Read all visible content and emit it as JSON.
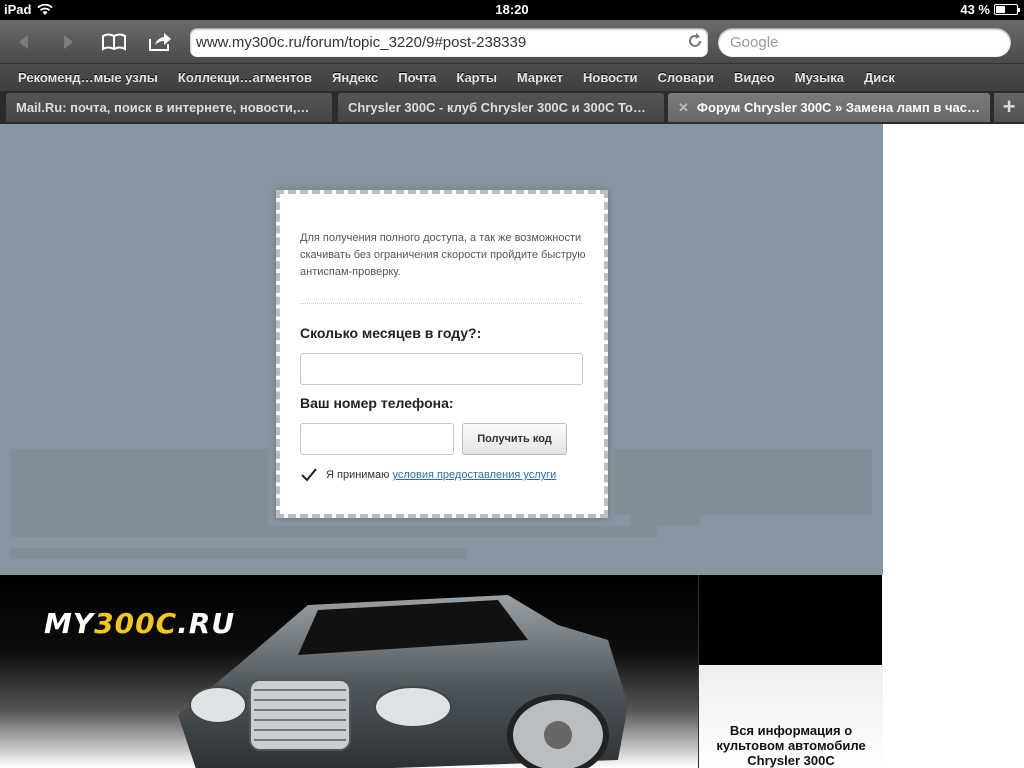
{
  "status_bar": {
    "device": "iPad",
    "time": "18:20",
    "battery": "43 %",
    "battery_level": 0.43
  },
  "toolbar": {
    "url": "www.my300c.ru/forum/topic_3220/9#post-238339",
    "search_placeholder": "Google",
    "icons": [
      "back-icon",
      "forward-icon",
      "bookmarks-icon",
      "share-icon",
      "reload-icon"
    ]
  },
  "bookmarks": [
    "Рекоменд…мые узлы",
    "Коллекци…агментов",
    "Яндекс",
    "Почта",
    "Карты",
    "Маркет",
    "Новости",
    "Словари",
    "Видео",
    "Музыка",
    "Диск"
  ],
  "tabs": [
    {
      "label": "Mail.Ru: почта, поиск в интернете, новости,…",
      "active": false
    },
    {
      "label": "Chrysler 300C - клуб Chrysler 300C и 300C To…",
      "active": false
    },
    {
      "label": "Форум Chrysler 300C » Замена ламп в час…",
      "active": true
    }
  ],
  "modal": {
    "intro": "Для получения полного доступа, а так же возможности скачивать без ограничения скорости пройдите быструю антиспам-проверку.",
    "question_label": "Сколько месяцев в году?:",
    "question_value": "",
    "phone_label": "Ваш номер телефона:",
    "phone_value": "",
    "get_code_button": "Получить код",
    "terms_prefix": "Я принимаю",
    "terms_link": "условия предоставления услуги"
  },
  "banner": {
    "logo_prefix": "MY",
    "logo_accent": "300C",
    "logo_suffix": ".RU",
    "side_text": "Вся информация о культовом автомобиле Chrysler 300C"
  },
  "colors": {
    "overlay": "#8796a0",
    "link": "#2a6db0",
    "logo_accent": "#f5c718"
  }
}
